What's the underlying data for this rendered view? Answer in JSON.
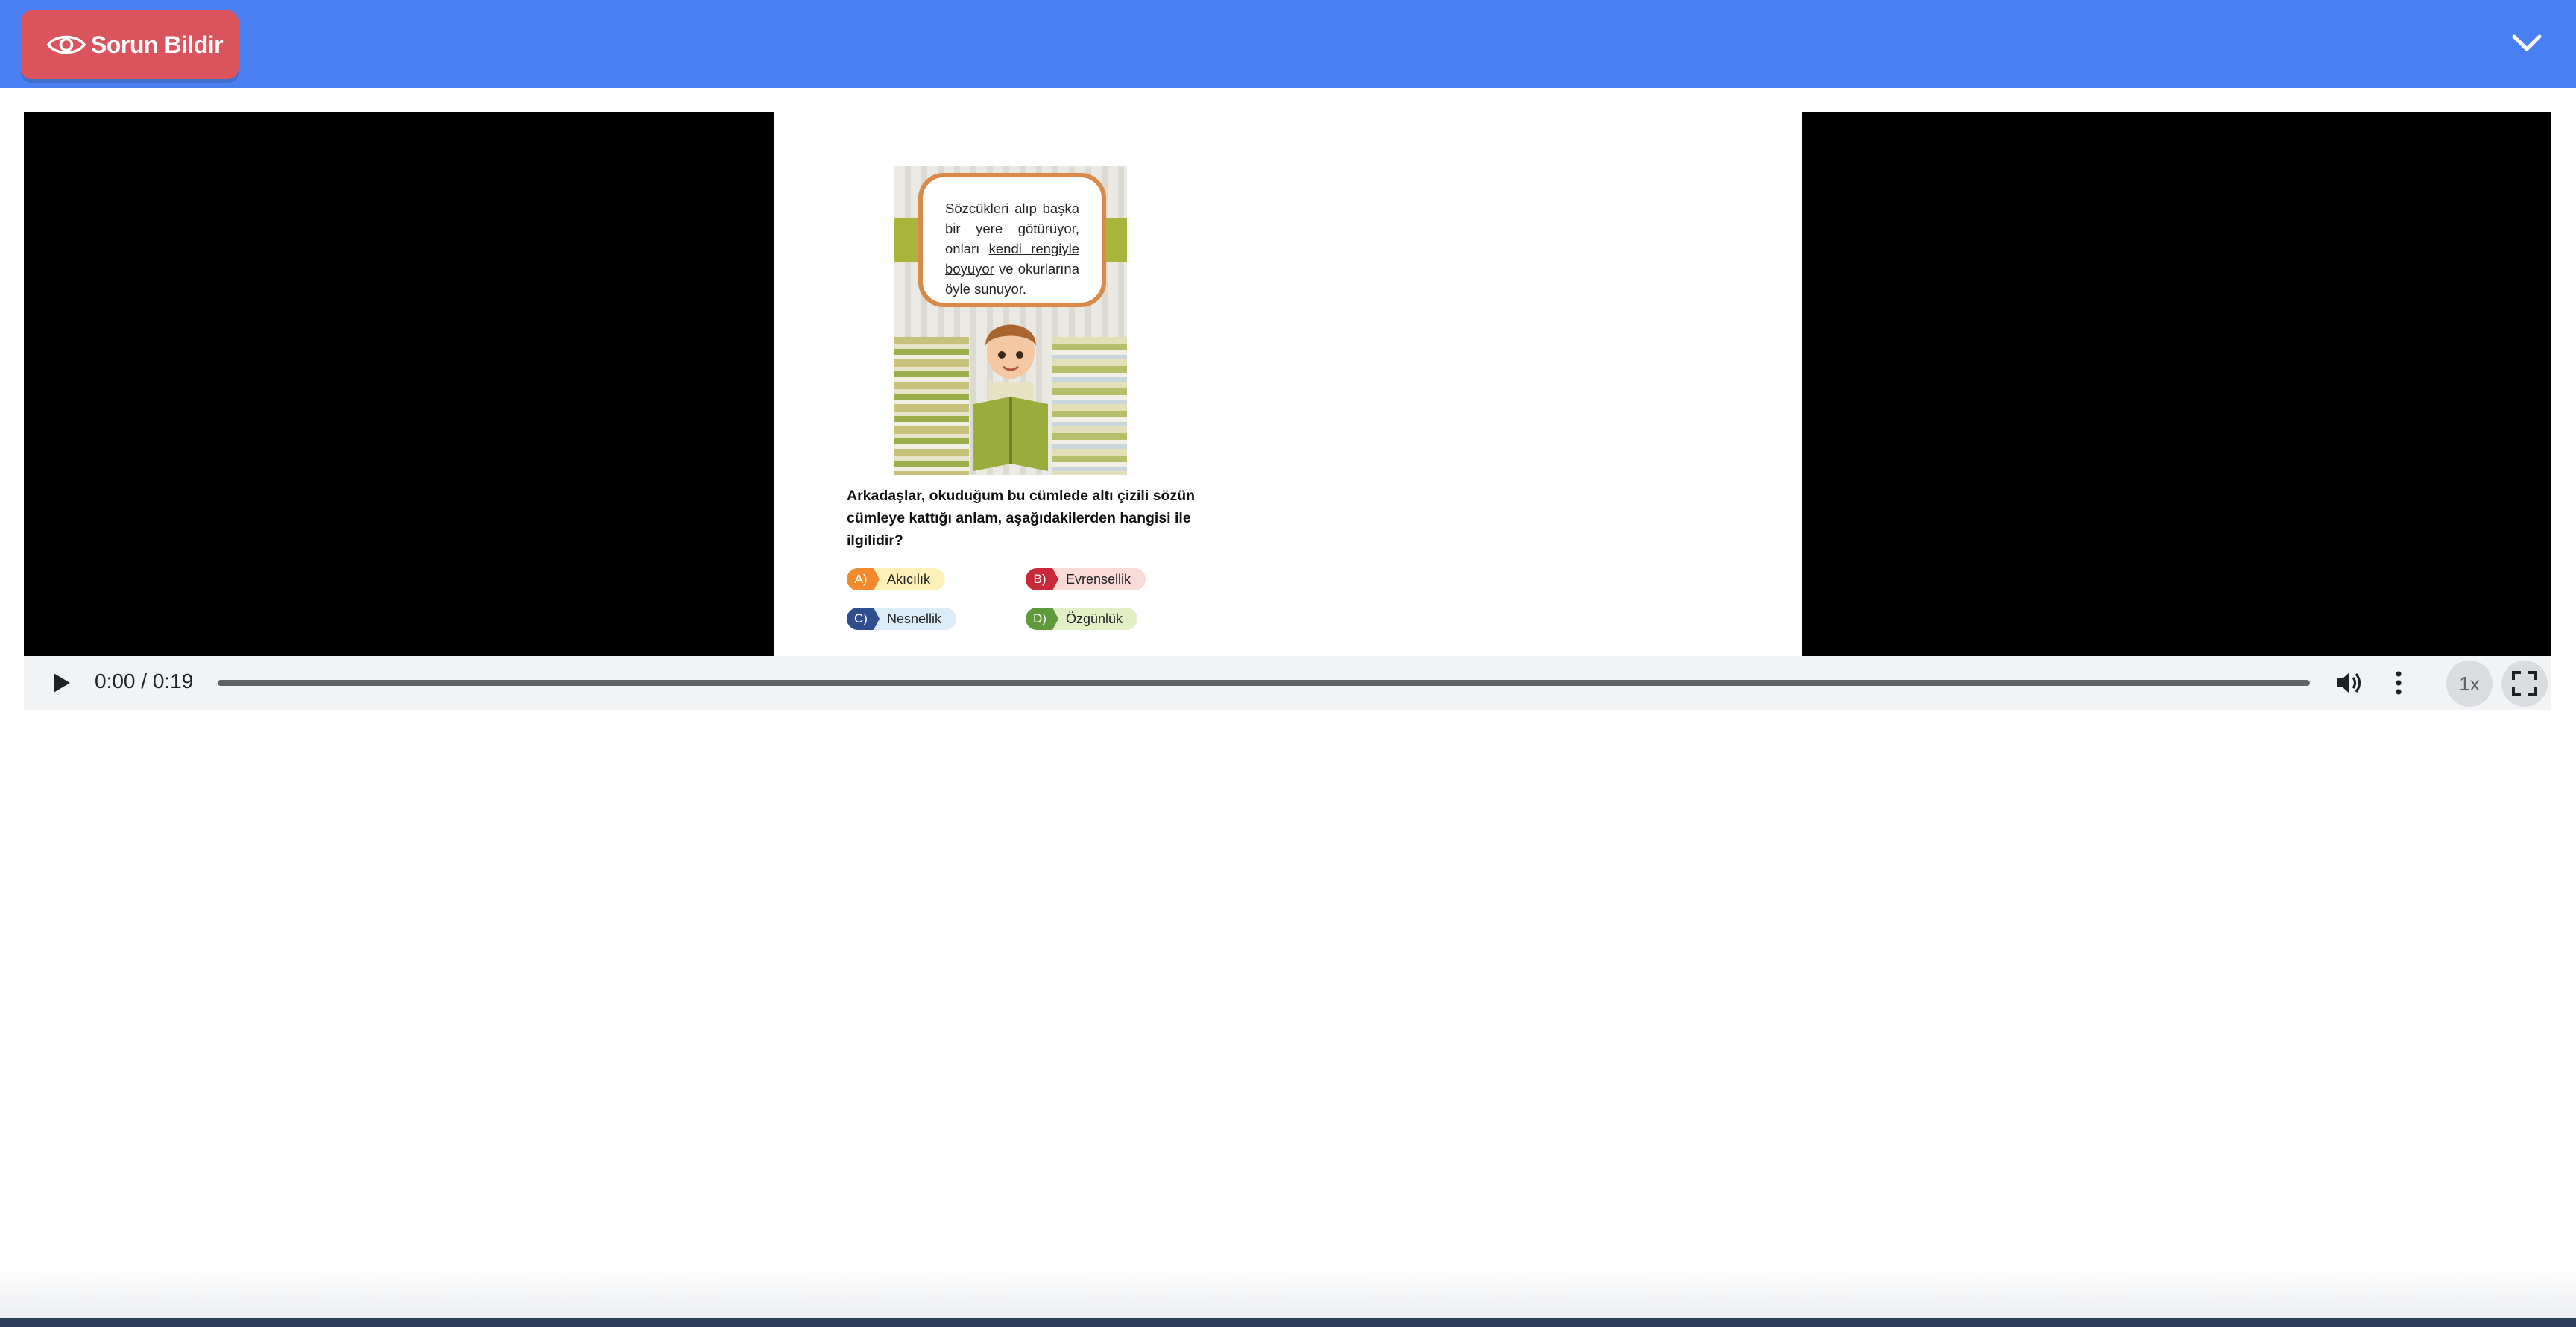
{
  "header": {
    "report_button_label": "Sorun Bildir",
    "report_icon": "eye-icon",
    "collapse_icon": "chevron-down-icon",
    "background_color": "#4a7ff1",
    "button_color": "#d9545c"
  },
  "slide": {
    "speech_text_1": "Sözcükleri alıp başka bir yere götürüyor, onları ",
    "speech_text_underlined": "kendi rengiyle boyuyor",
    "speech_text_2": " ve okurlarına öyle sunuyor.",
    "question": "Arkadaşlar, okuduğum bu cümlede altı çizili sözün cümleye kattığı anlam, aşağıdakilerden hangisi ile ilgilidir?",
    "options": [
      {
        "letter": "A)",
        "text": "Akıcılık",
        "tag_color": "#f08a2c",
        "bg_color": "#fdf1b9"
      },
      {
        "letter": "B)",
        "text": "Evrensellik",
        "tag_color": "#c8283a",
        "bg_color": "#f9dad6"
      },
      {
        "letter": "C)",
        "text": "Nesnellik",
        "tag_color": "#2f4e8f",
        "bg_color": "#d9ecf7"
      },
      {
        "letter": "D)",
        "text": "Özgünlük",
        "tag_color": "#5f9a3a",
        "bg_color": "#e2efc7"
      }
    ]
  },
  "player": {
    "play_icon": "play-icon",
    "time_display": "0:00 / 0:19",
    "progress": 0,
    "volume_icon": "volume-icon",
    "more_icon": "more-vert-icon",
    "speed_label": "1x",
    "fullscreen_icon": "fullscreen-icon"
  }
}
